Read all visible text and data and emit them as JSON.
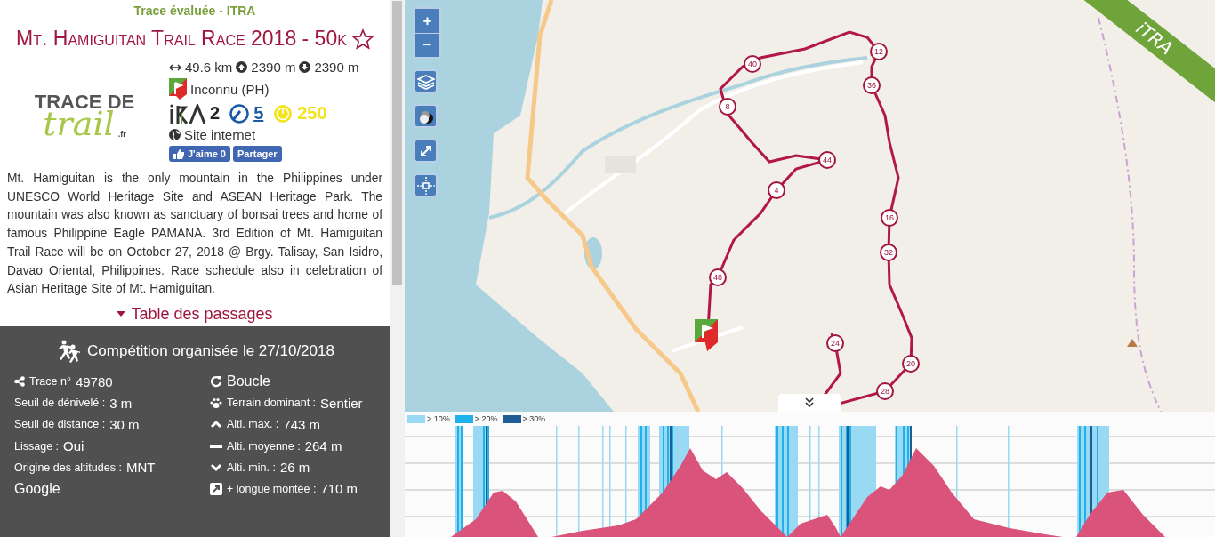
{
  "header": {
    "label": "Trace évaluée - ITRA"
  },
  "title": "Mt. Hamiguitan Trail Race 2018 - 50k",
  "logo": {
    "line1": "TRACE DE",
    "line2": "trail",
    "suffix": ".fr"
  },
  "stats": {
    "distance": "49.6 km",
    "ascent": "2390 m",
    "descent": "2390 m"
  },
  "country": "Inconnu (PH)",
  "scores": [
    {
      "kind": "itra",
      "value": "2"
    },
    {
      "kind": "endurance",
      "value": "5"
    },
    {
      "kind": "points",
      "value": "250"
    }
  ],
  "website": "Site internet",
  "social": [
    {
      "kind": "like",
      "label": "J'aime 0"
    },
    {
      "kind": "share",
      "label": "Partager"
    }
  ],
  "description": "Mt. Hamiguitan is the only mountain in the Philippines under UNESCO World Heritage Site and ASEAN Heritage Park. The mountain was also known as sanctuary of bonsai trees and home of famous Philippine Eagle PAMANA. 3rd Edition of Mt. Hamiguitan Trail Race will be on October 27, 2018 @ Brgy. Talisay, San Isidro, Davao Oriental, Philippines. Race schedule also in celebration of Asian Heritage Site of Mt. Hamiguitan.",
  "passages_link": "Table des passages",
  "competition": {
    "heading": "Compétition organisée le 27/10/2018",
    "left": [
      {
        "kind": "share",
        "label": "Trace n°",
        "value": "49780"
      },
      {
        "label": "Seuil de dénivelé :",
        "value": "3 m"
      },
      {
        "label": "Seuil de distance :",
        "value": "30 m"
      },
      {
        "label": "Lissage :",
        "value": "Oui"
      },
      {
        "label": "Origine des altitudes :",
        "value": "MNT"
      },
      {
        "value": "Google"
      }
    ],
    "right": [
      {
        "kind": "loop",
        "value": "Boucle"
      },
      {
        "kind": "paw",
        "label": "Terrain dominant :",
        "value": "Sentier"
      },
      {
        "kind": "up",
        "label": "Alti. max. :",
        "value": "743 m"
      },
      {
        "kind": "minus",
        "label": "Alti. moyenne :",
        "value": "264 m"
      },
      {
        "kind": "down",
        "label": "Alti. min. :",
        "value": "26 m"
      },
      {
        "kind": "climb",
        "label": "+ longue montée :",
        "value": "710 m"
      }
    ]
  },
  "map": {
    "controls": [
      {
        "kind": "zoom-in",
        "label": "+"
      },
      {
        "kind": "zoom-out",
        "label": "−"
      },
      {
        "kind": "layers"
      },
      {
        "kind": "contrast"
      },
      {
        "kind": "fullscreen"
      },
      {
        "kind": "locate"
      }
    ],
    "ribbon": "iTRA",
    "km_markers": [
      "12",
      "40",
      "36",
      "8",
      "44",
      "4",
      "16",
      "32",
      "48",
      "24",
      "20",
      "28"
    ]
  },
  "profile": {
    "legend": [
      {
        "label": "> 10%",
        "color": "#9ad9f4"
      },
      {
        "label": "> 20%",
        "color": "#1fb1ea"
      },
      {
        "label": "> 30%",
        "color": "#1c5d96"
      }
    ]
  }
}
